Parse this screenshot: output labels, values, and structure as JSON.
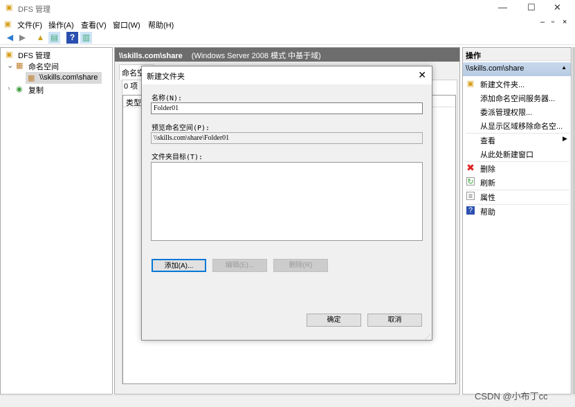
{
  "window": {
    "title": "DFS 管理",
    "minimize": "—",
    "maximize": "☐",
    "close": "✕"
  },
  "menu": [
    "文件(F)",
    "操作(A)",
    "查看(V)",
    "窗口(W)",
    "帮助(H)"
  ],
  "tree": {
    "root": "DFS 管理",
    "namespaces": "命名空间",
    "share": "\\\\skills.com\\share",
    "replication": "复制"
  },
  "center": {
    "header_title": "\\\\skills.com\\share",
    "header_sub": "(Windows Server 2008 模式 中基于域)",
    "tab": "命名空间",
    "count": "0 项",
    "col_type": "类型"
  },
  "actions": {
    "title": "操作",
    "section": "\\\\skills.com\\share",
    "items": [
      "新建文件夹...",
      "添加命名空间服务器...",
      "委派管理权限...",
      "从显示区域移除命名空...",
      "查看",
      "从此处新建窗口",
      "删除",
      "刷新",
      "属性",
      "帮助"
    ]
  },
  "dialog": {
    "title": "新建文件夹",
    "name_label": "名称(N):",
    "name_value": "Folder01",
    "preview_label": "预览命名空间(P):",
    "preview_value": "\\\\skills.com\\share\\Folder01",
    "targets_label": "文件夹目标(T):",
    "add": "添加(A)...",
    "edit": "编辑(E)...",
    "remove": "删除(R)",
    "ok": "确定",
    "cancel": "取消"
  },
  "watermark": "CSDN @小布丁cc"
}
